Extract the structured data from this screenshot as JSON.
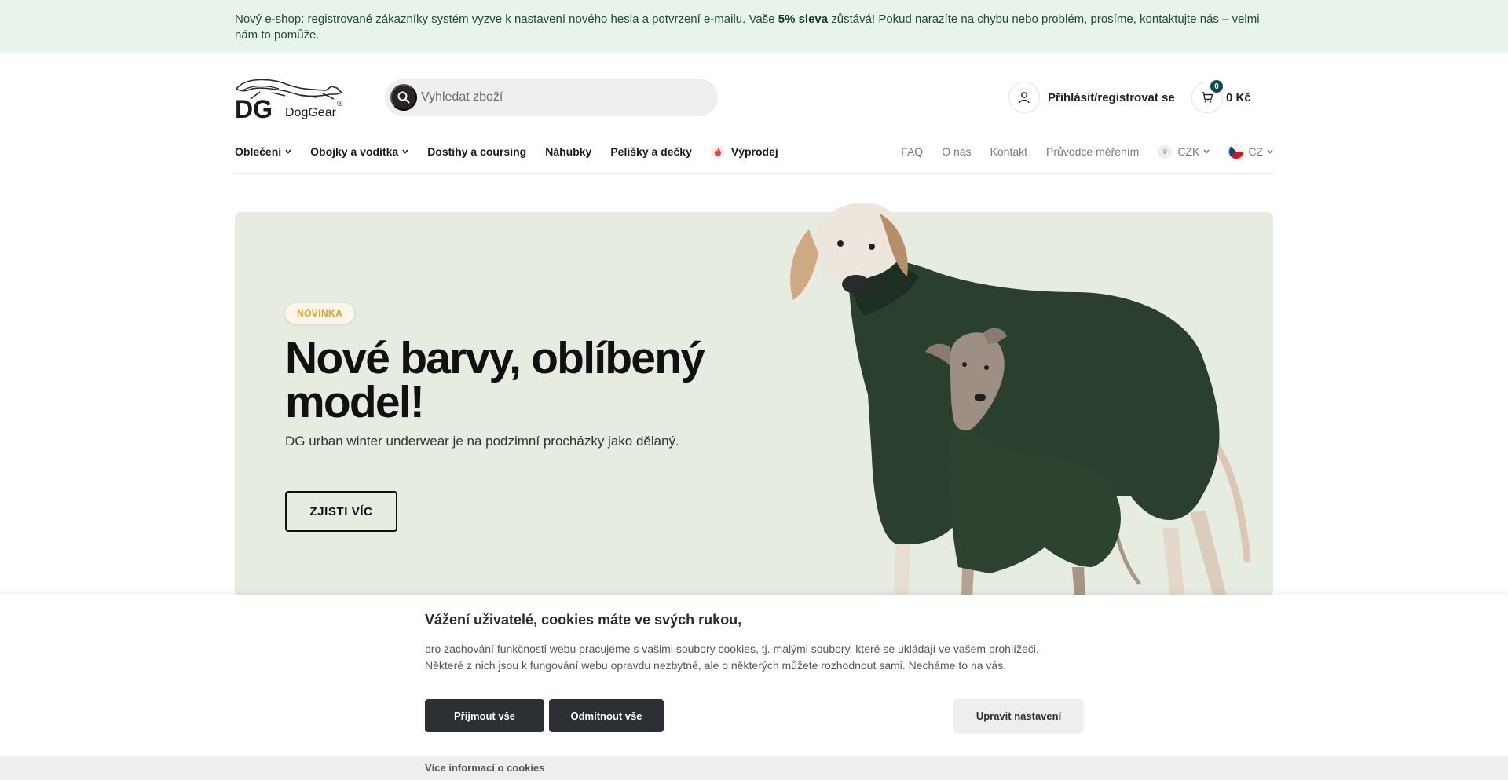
{
  "announcement": {
    "before": "Nový e-shop: registrované zákazníky systém vyzve k nastavení nového hesla a potvrzení e-mailu. Vaše ",
    "highlight": "5% sleva",
    "after": " zůstává! Pokud narazíte na chybu nebo problém, prosíme, kontaktujte nás – velmi nám to pomůže."
  },
  "brand": {
    "logo_mark": "DG",
    "name": "DogGear",
    "reg": "®"
  },
  "search": {
    "placeholder": "Vyhledat zboží",
    "icon": "search-icon"
  },
  "account": {
    "login_label": "Přihlásit/registrovat se",
    "icon": "user-icon"
  },
  "cart": {
    "count": "0",
    "total": "0 Kč",
    "icon": "cart-icon"
  },
  "nav": {
    "main": [
      {
        "label": "Oblečení",
        "dropdown": true
      },
      {
        "label": "Obojky a vodítka",
        "dropdown": true
      },
      {
        "label": "Dostihy a coursing"
      },
      {
        "label": "Náhubky"
      },
      {
        "label": "Pelíšky a dečky"
      },
      {
        "label": "Výprodej",
        "icon": "fire-icon"
      }
    ],
    "secondary": [
      {
        "label": "FAQ"
      },
      {
        "label": "O nás"
      },
      {
        "label": "Kontakt"
      },
      {
        "label": "Průvodce měřením"
      }
    ],
    "currency": "CZK",
    "language": "CZ"
  },
  "hero": {
    "badge": "NOVINKA",
    "title": "Nové barvy, oblíbený model!",
    "subtitle": "DG urban winter underwear je na podzimní procházky jako dělaný.",
    "cta": "ZJISTI VÍC",
    "image": "greyhound-dogs-in-green-sweaters"
  },
  "cookies": {
    "title": "Vážení uživatelé, cookies máte ve svých rukou,",
    "text_line1": "pro zachování funkčnosti webu pracujeme s vašimi soubory cookies, tj. malými soubory, které se ukládají ve vašem prohlížeči.",
    "text_line2": "Některé z nich jsou k fungování webu opravdu nezbytné, ale o některých můžete rozhodnout sami. Necháme to na vás.",
    "accept_all": "Přijmout vše",
    "reject_all": "Odmítnout vše",
    "settings": "Upravit nastavení",
    "more_info": "Více informací o cookies"
  },
  "colors": {
    "announcement_bg": "#e8f3ec",
    "hero_bg": "#e6ecdf",
    "badge_text": "#e0a31e",
    "cookie_button_dark": "#2c3034",
    "cart_badge": "#0e4a56"
  }
}
